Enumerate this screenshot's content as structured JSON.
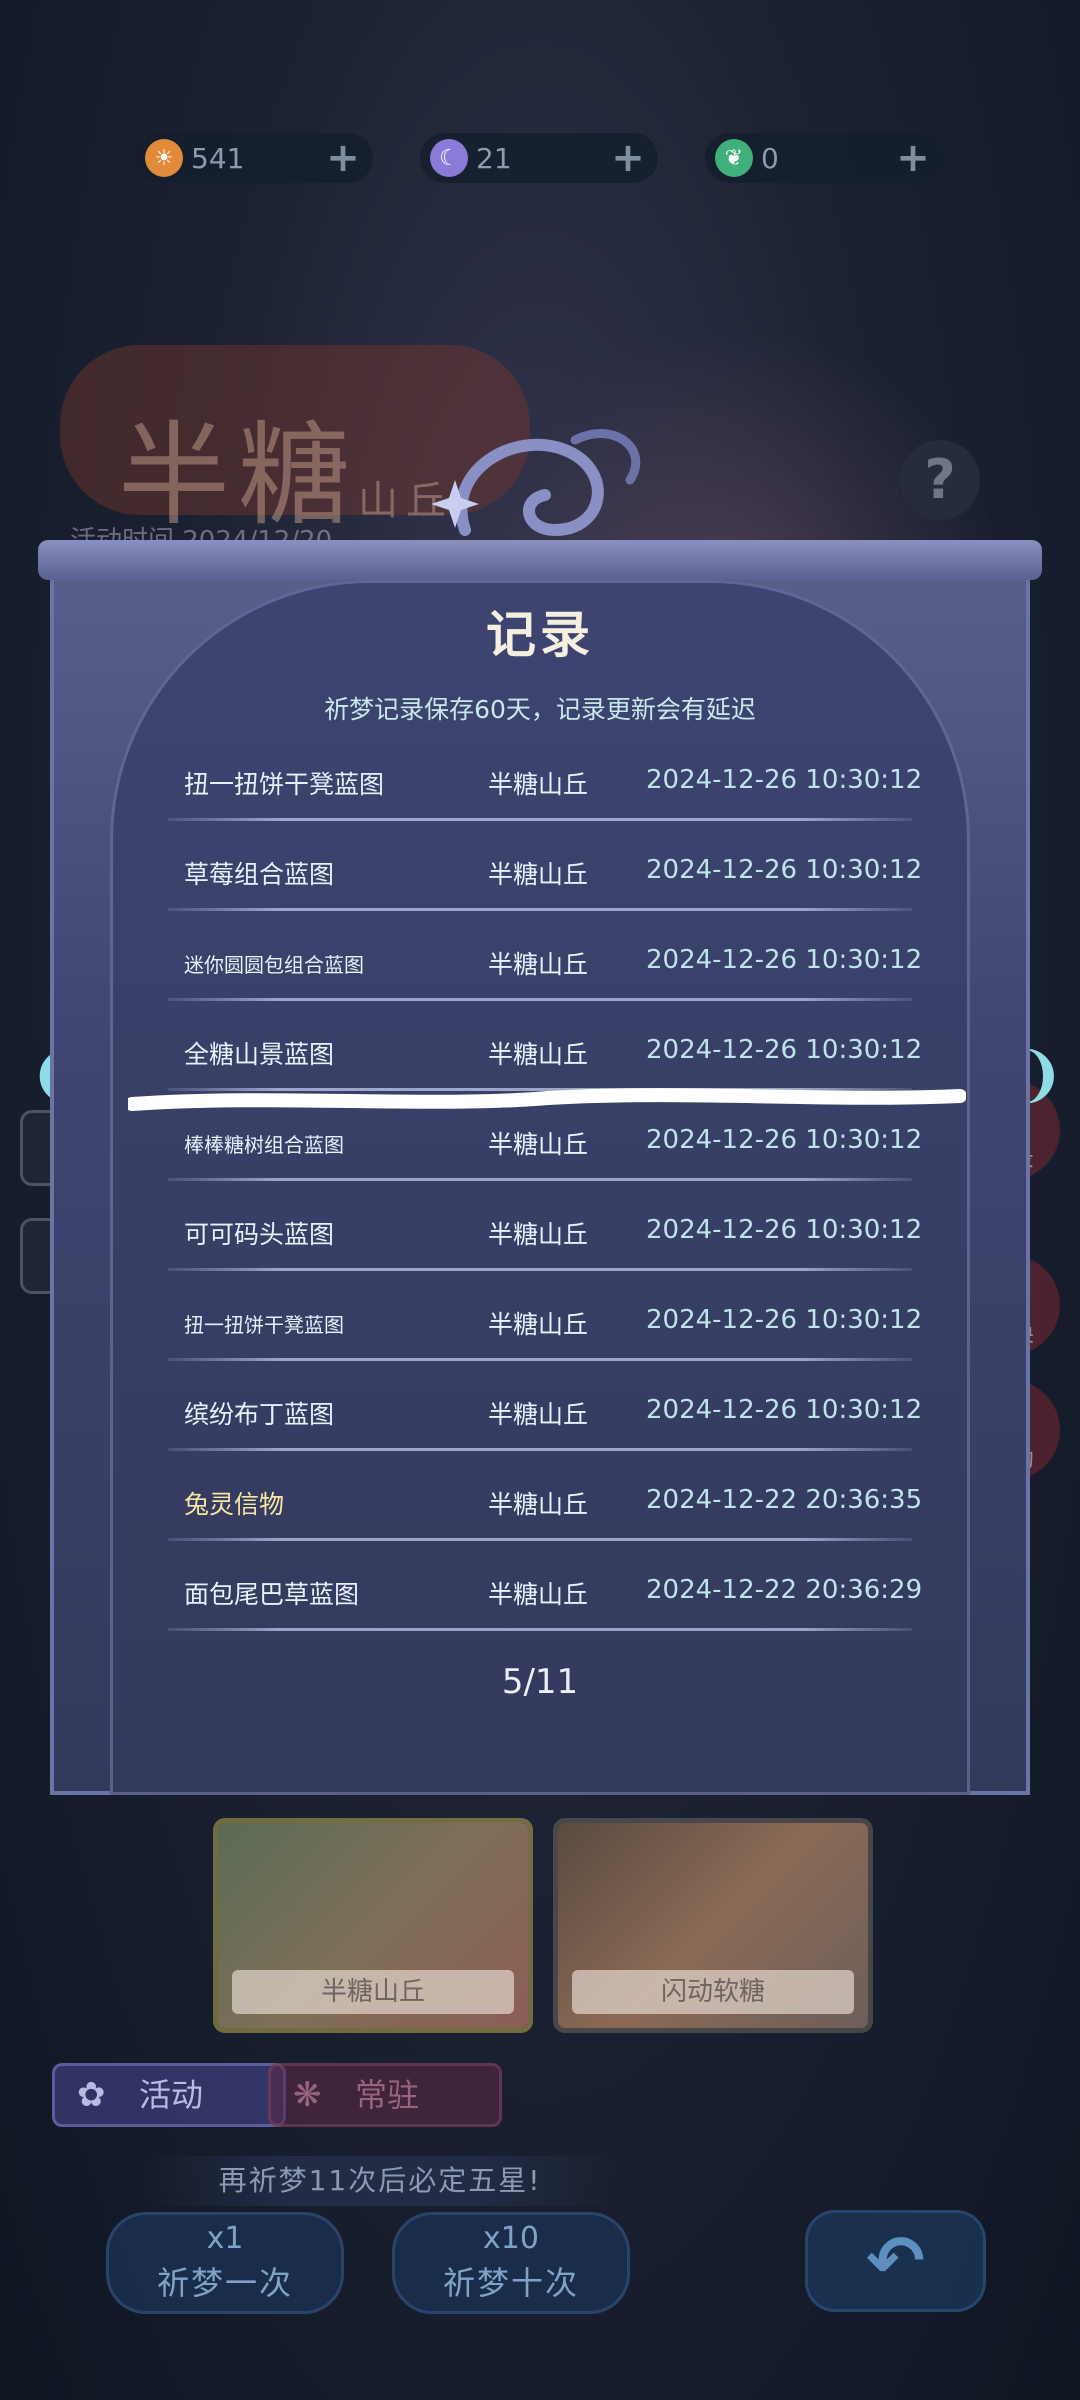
{
  "currencies": [
    {
      "icon": "sun-token-icon",
      "value": "541",
      "color": "#e08a3a"
    },
    {
      "icon": "moon-token-icon",
      "value": "21",
      "color": "#8c7ad8"
    },
    {
      "icon": "leaf-token-icon",
      "value": "0",
      "color": "#3fb07a"
    }
  ],
  "background": {
    "event_title": "半糖",
    "event_title_small": "山丘",
    "event_time": "活动时间 2024/12/20",
    "side_buttons": [
      "记录",
      "兑换",
      "奖励"
    ]
  },
  "modal": {
    "title": "记录",
    "subtitle": "祈梦记录保存60天，记录更新会有延迟",
    "records": [
      {
        "name": "扭一扭饼干凳蓝图",
        "pool": "半糖山丘",
        "time": "2024-12-26 10:30:12",
        "small": false,
        "highlight": false
      },
      {
        "name": "草莓组合蓝图",
        "pool": "半糖山丘",
        "time": "2024-12-26 10:30:12",
        "small": false,
        "highlight": false
      },
      {
        "name": "迷你圆圆包组合蓝图",
        "pool": "半糖山丘",
        "time": "2024-12-26 10:30:12",
        "small": true,
        "highlight": false
      },
      {
        "name": "全糖山景蓝图",
        "pool": "半糖山丘",
        "time": "2024-12-26 10:30:12",
        "small": false,
        "highlight": false
      },
      {
        "name": "棒棒糖树组合蓝图",
        "pool": "半糖山丘",
        "time": "2024-12-26 10:30:12",
        "small": true,
        "highlight": false
      },
      {
        "name": "可可码头蓝图",
        "pool": "半糖山丘",
        "time": "2024-12-26 10:30:12",
        "small": false,
        "highlight": false
      },
      {
        "name": "扭一扭饼干凳蓝图",
        "pool": "半糖山丘",
        "time": "2024-12-26 10:30:12",
        "small": true,
        "highlight": false
      },
      {
        "name": "缤纷布丁蓝图",
        "pool": "半糖山丘",
        "time": "2024-12-26 10:30:12",
        "small": false,
        "highlight": false
      },
      {
        "name": "兔灵信物",
        "pool": "半糖山丘",
        "time": "2024-12-22 20:36:35",
        "small": false,
        "highlight": true
      },
      {
        "name": "面包尾巴草蓝图",
        "pool": "半糖山丘",
        "time": "2024-12-22 20:36:29",
        "small": false,
        "highlight": false
      }
    ],
    "page": "5/11"
  },
  "banners": [
    {
      "label": "半糖山丘"
    },
    {
      "label": "闪动软糖"
    }
  ],
  "tabs": [
    {
      "label": "活动"
    },
    {
      "label": "常驻"
    }
  ],
  "pity_text": "再祈梦11次后必定五星!",
  "pray_buttons": [
    {
      "cost": "x1",
      "label": "祈梦一次"
    },
    {
      "cost": "x10",
      "label": "祈梦十次"
    }
  ],
  "icons": {
    "help": "?",
    "left_arrow": "❨",
    "right_arrow": "❩",
    "back": "↶"
  }
}
